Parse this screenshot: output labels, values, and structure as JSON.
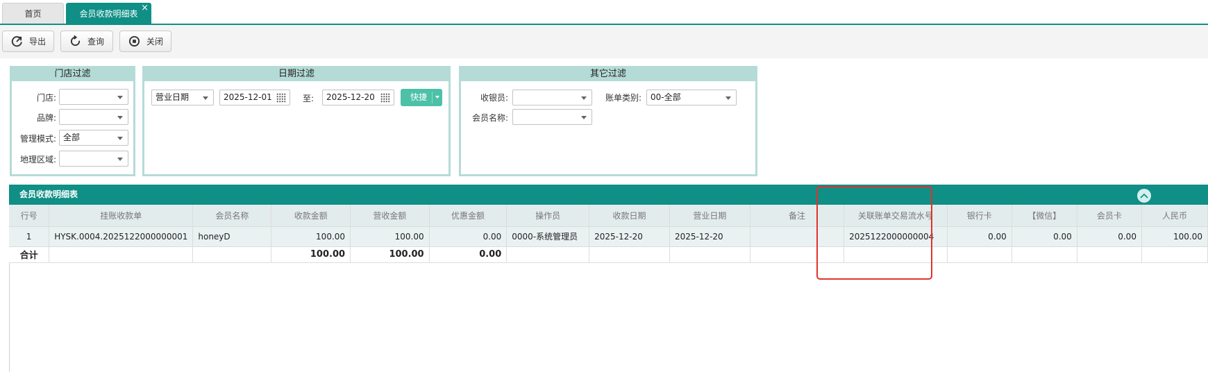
{
  "tabs": [
    {
      "label": "首页"
    },
    {
      "label": "会员收款明细表",
      "close": "×"
    }
  ],
  "toolbar": {
    "export": "导出",
    "query": "查询",
    "close": "关闭"
  },
  "filters": {
    "store": {
      "title": "门店过滤",
      "store_label": "门店:",
      "store_value": "",
      "brand_label": "品牌:",
      "brand_value": "",
      "mode_label": "管理模式:",
      "mode_value": "全部",
      "region_label": "地理区域:",
      "region_value": ""
    },
    "date": {
      "title": "日期过滤",
      "type_value": "营业日期",
      "from": "2025-12-01",
      "to_label": "至:",
      "to": "2025-12-20",
      "quick": "快捷"
    },
    "other": {
      "title": "其它过滤",
      "cashier_label": "收银员:",
      "cashier_value": "",
      "billtype_label": "账单类别:",
      "billtype_value": "00-全部",
      "member_label": "会员名称:",
      "member_value": ""
    }
  },
  "grid": {
    "title": "会员收款明细表",
    "columns": [
      "行号",
      "挂账收款单",
      "会员名称",
      "收款金额",
      "营收金额",
      "优惠金额",
      "操作员",
      "收款日期",
      "营业日期",
      "备注",
      "关联账单交易流水号",
      "银行卡",
      "【微信】",
      "会员卡",
      "人民币"
    ],
    "rows": [
      [
        "1",
        "HYSK.0004.2025122000000001",
        "honeyD",
        "100.00",
        "100.00",
        "0.00",
        "0000-系统管理员",
        "2025-12-20",
        "2025-12-20",
        "",
        "2025122000000004",
        "0.00",
        "0.00",
        "0.00",
        "100.00"
      ]
    ],
    "total": {
      "label": "合计",
      "collect": "100.00",
      "revenue": "100.00",
      "discount": "0.00"
    }
  },
  "colors": {
    "theme": "#0f8f86",
    "filter_header": "#b5dbd7",
    "quick_button": "#4cc1a7",
    "highlight": "#e0322c"
  }
}
